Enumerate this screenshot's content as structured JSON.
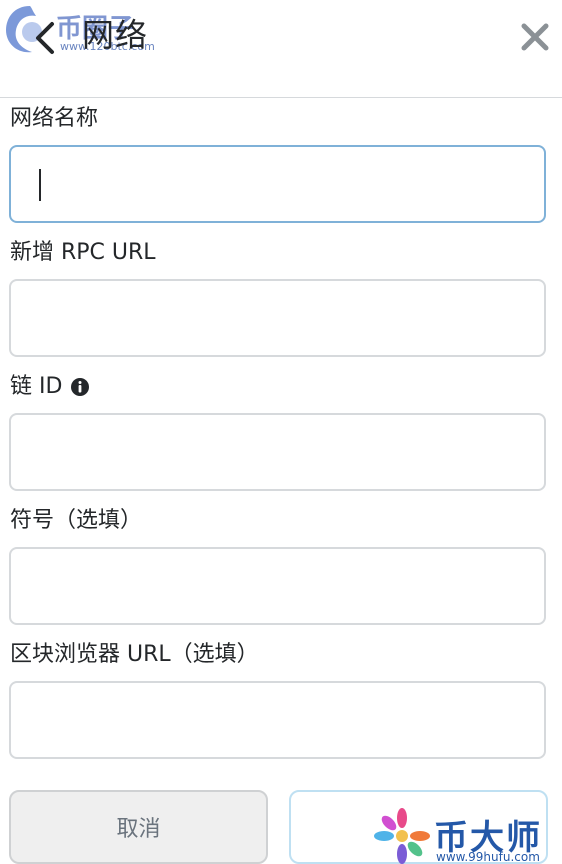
{
  "header": {
    "title": "网络",
    "back_icon": "chevron-left-icon",
    "close_icon": "close-icon"
  },
  "watermarks": {
    "top_left": {
      "text": "币圈子",
      "url": "www.120btc.com"
    },
    "bottom_right": {
      "text": "币大师",
      "url": "www.99hufu.com"
    }
  },
  "form": {
    "network_name": {
      "label": "网络名称",
      "value": ""
    },
    "rpc_url": {
      "label": "新增 RPC URL",
      "value": ""
    },
    "chain_id": {
      "label": "链 ID",
      "value": "",
      "info_icon": "info-icon"
    },
    "symbol": {
      "label": "符号（选填）",
      "value": ""
    },
    "explorer_url": {
      "label": "区块浏览器 URL（选填）",
      "value": ""
    }
  },
  "buttons": {
    "cancel": "取消",
    "save": ""
  },
  "colors": {
    "focus_border": "#7fb1d8",
    "field_border": "#d6d9dc",
    "text": "#24272a"
  }
}
